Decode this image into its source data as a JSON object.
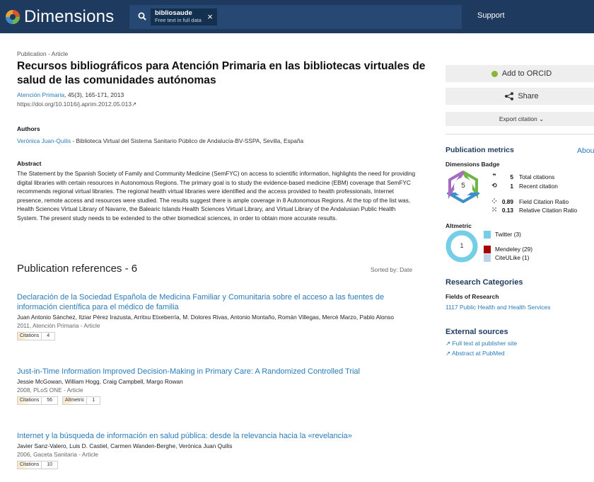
{
  "header": {
    "logo_text": "Dimensions",
    "search_term": "bibliosaude",
    "search_scope": "Free text in full data",
    "support_label": "Support"
  },
  "publication": {
    "type_label": "Publication - Article",
    "title": "Recursos bibliográficos para Atención Primaria en las bibliotecas virtuales de salud de las comunidades autónomas",
    "journal_name": "Atención Primaria",
    "journal_details": ", 45(3), 165-171, 2013",
    "doi": "https://doi.org/10.1016/j.aprim.2012.05.013",
    "authors_heading": "Authors",
    "author_name": "Verónica Juan-Quilis",
    "author_affiliation": " - Biblioteca Virtual del Sistema Sanitario Público de Andalucía-BV-SSPA, Sevilla, España",
    "abstract_heading": "Abstract",
    "abstract": "The Statement by the Spanish Society of Family and Community Medicine (SemFYC) on access to scientific information, highlights the need for providing digital libraries with certain resources in Autonomous Regions. The primary goal is to study the evidence-based medicine (EBM) coverage that SemFYC recommends regional virtual libraries. The regional health virtual libraries were identified and the access provided to health professionals, Internet presence, remote access and resources were studied. The results suggest there is ample coverage in 8 Autonomous Regions. At the top of the list was, Health Sciences Virtual Library of Navarre, the Balearic Islands Health Sciences Virtual Library, and Virtual Library of the Andalusian Public Health System. The present study needs to be extended to the other biomedical sciences, in order to obtain more accurate results."
  },
  "references": {
    "heading": "Publication references - 6",
    "sorted_by": "Sorted by: Date",
    "items": [
      {
        "title": "Declaración de la Sociedad Española de Medicina Familiar y Comunitaria sobre el acceso a las fuentes de información científica para el médico de familia",
        "authors": "Juan Antonio Sánchez, Itziar Pérez Irazusta, Arritxu Etxeberría, M. Dolores Rivas, Antonio Montaño, Román Villegas, Mercè Marzo, Pablo Alonso",
        "meta": "2011, Atención Primaria - Article",
        "citations_label": "Citations",
        "citations": "4"
      },
      {
        "title": "Just-in-Time Information Improved Decision-Making in Primary Care: A Randomized Controlled Trial",
        "authors": "Jessie McGowan, William Hogg, Craig Campbell, Margo Rowan",
        "meta": "2008, PLoS ONE - Article",
        "citations_label": "Citations",
        "citations": "56",
        "altmetric_label": "Altmetric",
        "altmetric": "1"
      },
      {
        "title": "Internet y la búsqueda de información en salud pública: desde la relevancia hacia la «revelancia»",
        "authors": "Javier Sanz-Valero, Luis D. Castiel, Carmen Wanden-Berghe, Verónica Juan Quilis",
        "meta": "2006, Gaceta Sanitaria - Article",
        "citations_label": "Citations",
        "citations": "10"
      }
    ]
  },
  "sidebar": {
    "orcid_label": "Add to ORCID",
    "share_label": "Share",
    "export_label": "Export citation",
    "metrics_heading": "Publication metrics",
    "about_label": "Abou",
    "badge_heading": "Dimensions Badge",
    "badge_value": "5",
    "metrics": [
      {
        "icon": "quote-icon",
        "value": "5",
        "label": "Total citations"
      },
      {
        "icon": "recent-icon",
        "value": "1",
        "label": "Recent citation"
      },
      {
        "icon": "field-ratio-icon",
        "value": "0.89",
        "label": "Field Citation Ratio"
      },
      {
        "icon": "relative-ratio-icon",
        "value": "0.13",
        "label": "Relative Citation Ratio"
      }
    ],
    "altmetric_heading": "Altmetric",
    "altmetric_value": "1",
    "altmetric_sources": [
      {
        "label": "Twitter (3)",
        "color": "#74cfe6"
      },
      {
        "label": "Mendeley (29)",
        "color": "#a60000"
      },
      {
        "label": "CiteULike (1)",
        "color": "#bcd3ec"
      }
    ],
    "research_heading": "Research Categories",
    "fields_heading": "Fields of Research",
    "field_value": "1117 Public Health and Health Services",
    "external_heading": "External sources",
    "external_links": [
      "Full text at publisher site",
      "Abstract at PubMed"
    ]
  }
}
